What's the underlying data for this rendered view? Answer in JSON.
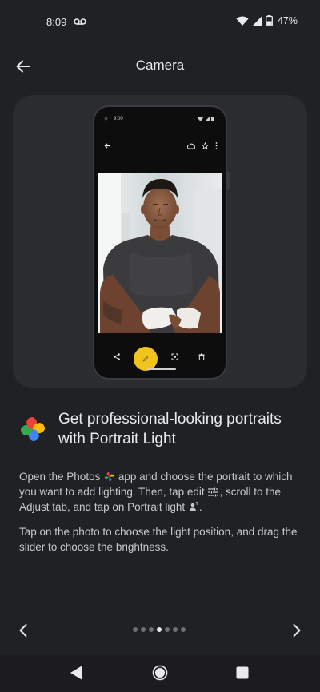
{
  "status_bar": {
    "time": "8:09",
    "battery": "47%",
    "icons": [
      "voicemail-icon",
      "wifi-icon",
      "signal-icon",
      "battery-icon"
    ]
  },
  "app_bar": {
    "title": "Camera",
    "back_icon": "arrow-back-icon"
  },
  "illustration": {
    "phone_time": "9:00",
    "toolbar_icons": [
      "back-icon",
      "cloud-icon",
      "star-icon",
      "more-icon"
    ],
    "bottom_icons": [
      "share-icon",
      "edit-icon",
      "lens-icon",
      "trash-icon"
    ],
    "fab_color": "#f2c31e"
  },
  "feature": {
    "title": "Get professional-looking portraits with Portrait Light",
    "logo_icon": "google-photos-icon",
    "para1": {
      "part1": "Open the Photos",
      "part2": "app and choose the portrait to which you want to add lighting. Then, tap edit",
      "part3": ", scroll to the Adjust tab, and tap on Portrait light",
      "part4": "."
    },
    "para2": "Tap on the photo to choose the light position, and drag the slider to choose the brightness."
  },
  "pager": {
    "total_pages": 7,
    "current_page": 4,
    "prev_icon": "chevron-left-icon",
    "next_icon": "chevron-right-icon"
  },
  "nav_bar": {
    "icons": [
      "nav-back-icon",
      "nav-home-icon",
      "nav-recents-icon"
    ]
  },
  "colors": {
    "background": "#202124",
    "card": "#2b2c2f",
    "text_primary": "#e8eaed",
    "text_secondary": "#c7c9cc"
  }
}
